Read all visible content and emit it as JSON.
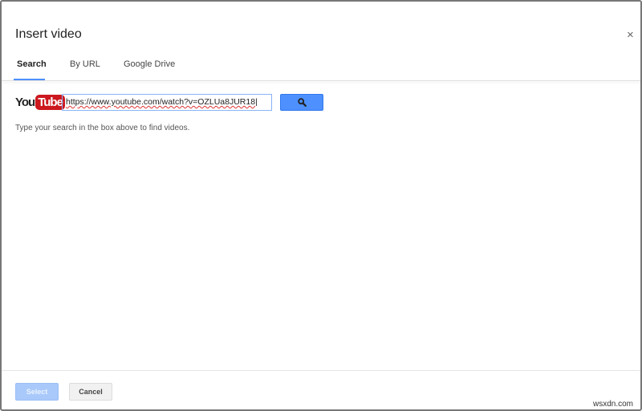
{
  "dialog": {
    "title": "Insert video",
    "close_label": "×"
  },
  "tabs": [
    {
      "label": "Search",
      "active": true
    },
    {
      "label": "By URL",
      "active": false
    },
    {
      "label": "Google Drive",
      "active": false
    }
  ],
  "search": {
    "logo_you": "You",
    "logo_tube": "Tube",
    "input_value": "https://www.youtube.com/watch?v=OZLUa8JUR18",
    "button_icon": "search-icon",
    "hint": "Type your search in the box above to find videos."
  },
  "footer": {
    "select_label": "Select",
    "cancel_label": "Cancel"
  },
  "watermark": "wsxdn.com",
  "colors": {
    "accent": "#4d90fe",
    "select_disabled": "#a9c9fb",
    "youtube_red": "#cc181e"
  }
}
